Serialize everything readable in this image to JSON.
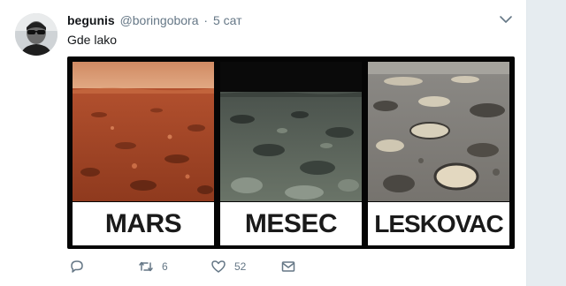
{
  "tweet": {
    "author_name": "begunis",
    "author_handle": "@boringobora",
    "separator": "·",
    "timestamp": "5 сат",
    "text": "Gde lako",
    "avatar_icon": "user-avatar",
    "menu_icon": "chevron-down-icon"
  },
  "media": {
    "panels": [
      {
        "label": "MARS",
        "scene": "mars-surface"
      },
      {
        "label": "MESEC",
        "scene": "moon-surface"
      },
      {
        "label": "LESKOVAC",
        "scene": "potholed-road"
      }
    ]
  },
  "actions": {
    "reply_icon": "reply-icon",
    "retweet_icon": "retweet-icon",
    "retweet_count": "6",
    "like_icon": "heart-icon",
    "like_count": "52",
    "message_icon": "envelope-icon"
  },
  "colors": {
    "text_primary": "#14171a",
    "text_secondary": "#657786",
    "page_background": "#e6ecf0"
  }
}
